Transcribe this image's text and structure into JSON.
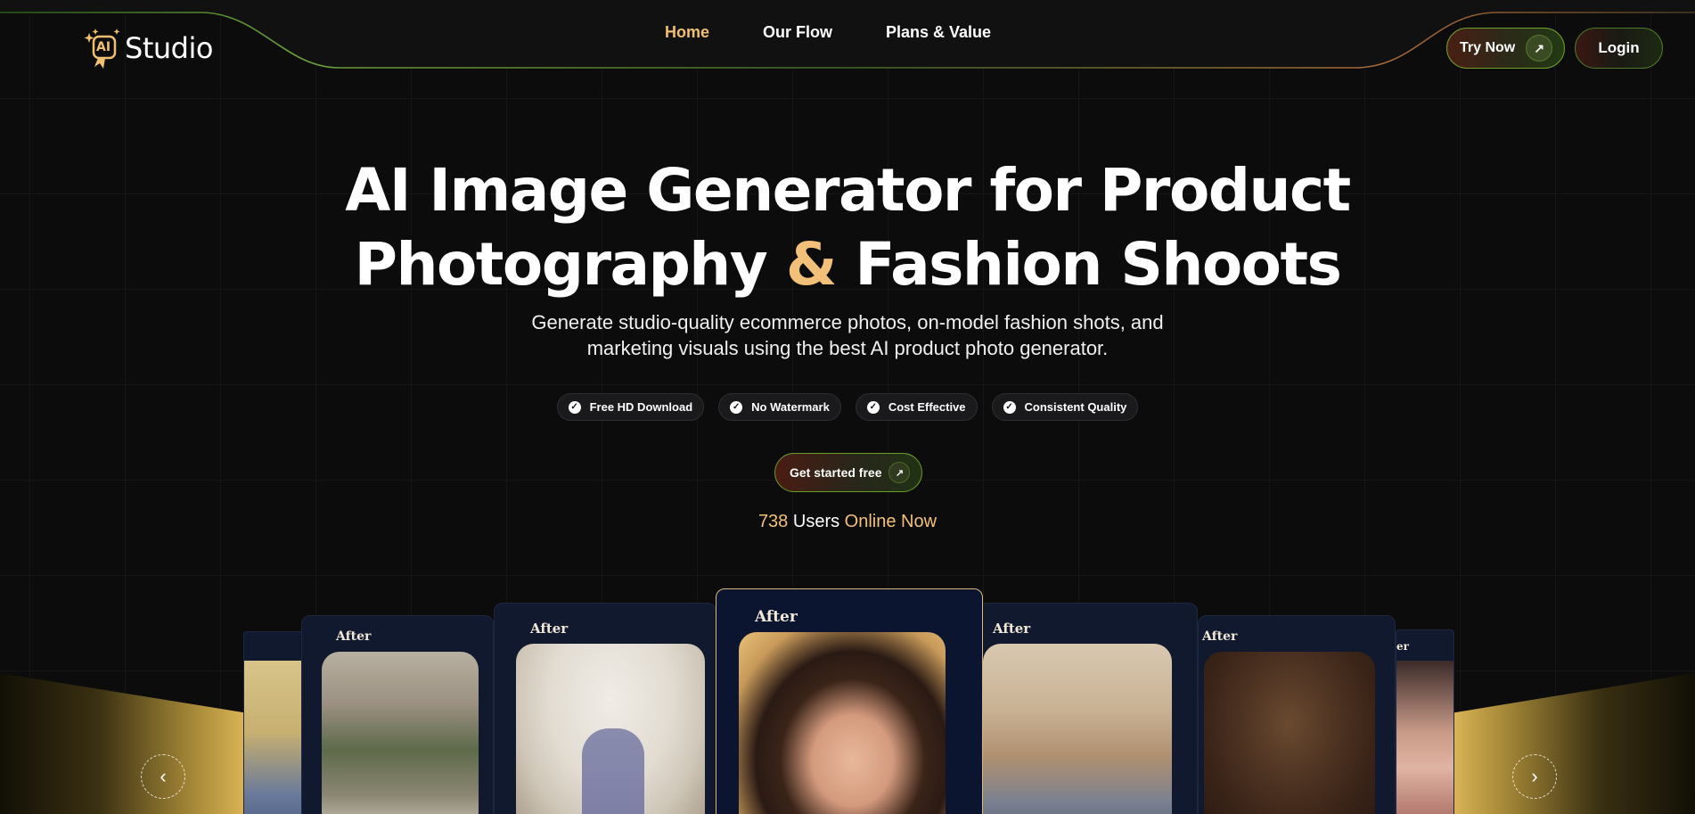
{
  "brand": {
    "logo_badge": "AI",
    "name": "Studio"
  },
  "nav": {
    "items": [
      "Home",
      "Our Flow",
      "Plans & Value"
    ],
    "active": "Home"
  },
  "header_actions": {
    "try_now": "Try Now",
    "login": "Login"
  },
  "hero": {
    "title_line1": "AI Image Generator for Product",
    "title_line2_a": "Photography",
    "title_line2_amp": "&",
    "title_line2_b": "Fashion Shoots",
    "subtitle": "Generate studio-quality ecommerce photos, on-model fashion shots, and marketing visuals using the best AI product photo generator.",
    "badges": [
      "Free HD Download",
      "No Watermark",
      "Cost Effective",
      "Consistent Quality"
    ],
    "cta": "Get started free",
    "online_count": "738",
    "online_users": "Users",
    "online_now": "Online Now"
  },
  "carousel": {
    "card_label": "After",
    "partial_label": "er",
    "prev_icon": "chevron-left-icon",
    "next_icon": "chevron-right-icon"
  },
  "colors": {
    "accent": "#f2c078",
    "background": "#0c0c0d",
    "cta_border": "#6fa02c"
  }
}
